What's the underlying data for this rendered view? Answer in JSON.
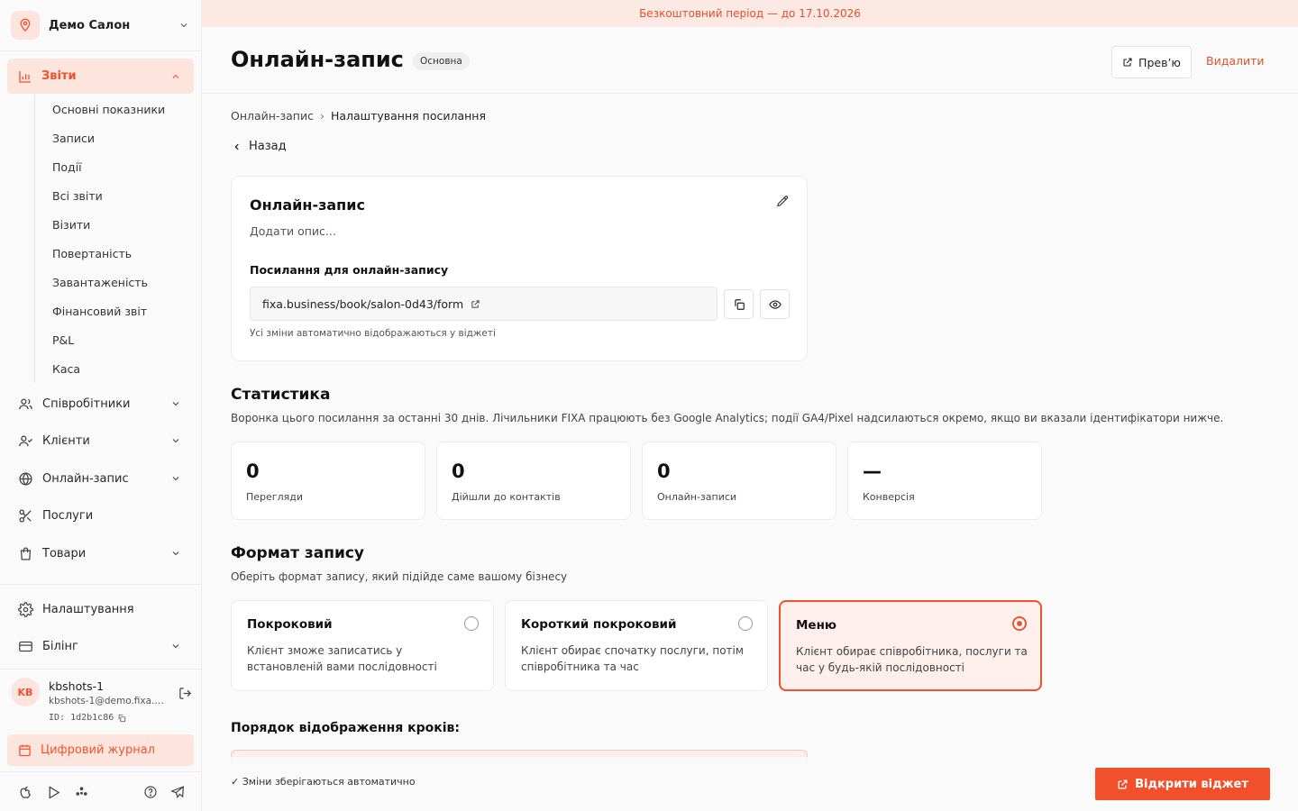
{
  "colors": {
    "accent": "#f0532c",
    "accent_bg": "#fde5de",
    "banner_text": "#e0502b"
  },
  "sidebar": {
    "salon_name": "Демо Салон",
    "reports": {
      "label": "Звіти",
      "items": [
        "Основні показники",
        "Записи",
        "Події",
        "Всі звіти",
        "Візити",
        "Повертаність",
        "Завантаженість",
        "Фінансовий звіт",
        "P&L",
        "Каса"
      ]
    },
    "nav": {
      "employees": "Співробітники",
      "clients": "Клієнти",
      "online": "Онлайн-запис",
      "services": "Послуги",
      "products": "Товари",
      "settings": "Налаштування",
      "billing": "Білінг"
    },
    "user": {
      "initials": "KB",
      "name": "kbshots-1",
      "email": "kbshots-1@demo.fixa.b...",
      "id": "ID: 1d2b1c86"
    },
    "journal_label": "Цифровий журнал"
  },
  "banner": {
    "text": "Безкоштовний період — до 17.10.2026"
  },
  "header": {
    "title": "Онлайн-запис",
    "badge": "Основна",
    "preview_label": "Прев’ю",
    "delete_label": "Видалити"
  },
  "breadcrumb": {
    "parent": "Онлайн-запис",
    "separator": "›",
    "current": "Налаштування посилання"
  },
  "back_label": "Назад",
  "link_card": {
    "title": "Онлайн-запис",
    "description": "Додати опис...",
    "link_label": "Посилання для онлайн-запису",
    "url": "fixa.business/book/salon-0d43/form",
    "hint": "Усі зміни автоматично відображаються у віджеті"
  },
  "stats": {
    "title": "Статистика",
    "subtitle": "Воронка цього посилання за останні 30 днів. Лічильники FIXA працюють без Google Analytics; події GA4/Pixel надсилаються окремо, якщо ви вказали ідентифікатори нижче.",
    "cards": [
      {
        "value": "0",
        "label": "Перегляди"
      },
      {
        "value": "0",
        "label": "Дійшли до контактів"
      },
      {
        "value": "0",
        "label": "Онлайн-записи"
      },
      {
        "value": "—",
        "label": "Конверсія"
      }
    ]
  },
  "format": {
    "title": "Формат запису",
    "subtitle": "Оберіть формат запису, який підійде саме вашому бізнесу",
    "options": [
      {
        "title": "Покроковий",
        "desc": "Клієнт зможе записатись у встановленій вами послідовності",
        "selected": false
      },
      {
        "title": "Короткий покроковий",
        "desc": "Клієнт обирає спочатку послуги, потім співробітника та час",
        "selected": false
      },
      {
        "title": "Меню",
        "desc": "Клієнт обирає співробітника, послуги та час у будь-якій послідовності",
        "selected": true
      }
    ]
  },
  "steps_title": "Порядок відображення кроків:",
  "footer": {
    "autosave": "✓ Зміни зберігаються автоматично",
    "open_widget_label": "Відкрити віджет"
  }
}
